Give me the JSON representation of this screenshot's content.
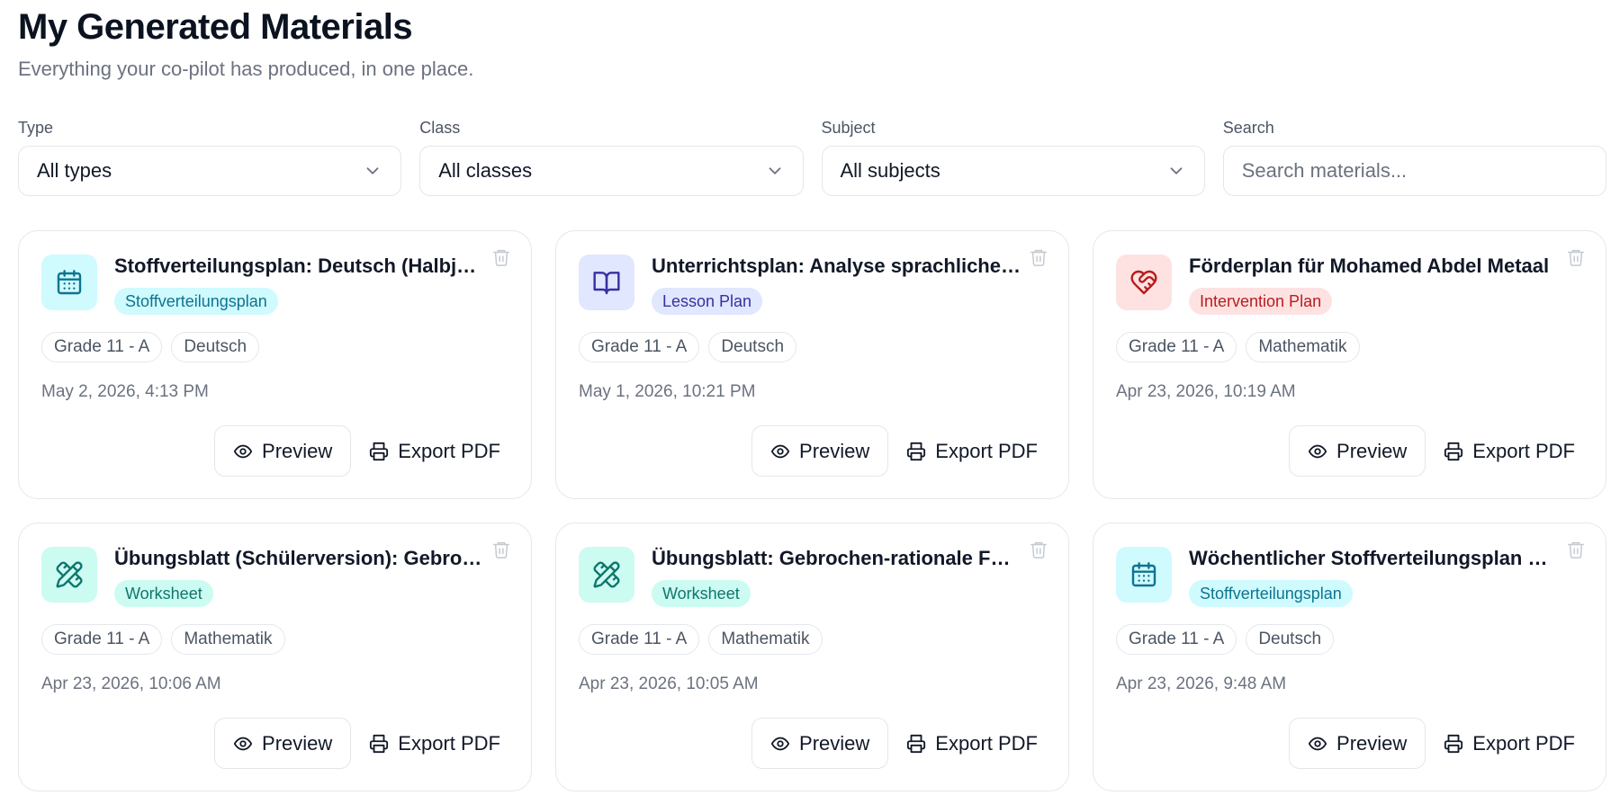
{
  "header": {
    "title": "My Generated Materials",
    "subtitle": "Everything your co-pilot has produced, in one place."
  },
  "filters": {
    "type": {
      "label": "Type",
      "value": "All types"
    },
    "class": {
      "label": "Class",
      "value": "All classes"
    },
    "subject": {
      "label": "Subject",
      "value": "All subjects"
    },
    "search": {
      "label": "Search",
      "placeholder": "Search materials..."
    }
  },
  "actions": {
    "preview_label": "Preview",
    "export_label": "Export PDF"
  },
  "colors": {
    "calendar_bg": "#cffafe",
    "calendar_fg": "#0e7490",
    "lesson_bg": "#e0e7ff",
    "lesson_fg": "#3730a3",
    "intervention_bg": "#fee2e2",
    "intervention_fg": "#b91c1c",
    "worksheet_bg": "#ccfbf1",
    "worksheet_fg": "#0f766e"
  },
  "materials": [
    {
      "title": "Stoffverteilungsplan: Deutsch (Halbjahr)",
      "type": "Stoffverteilungsplan",
      "icon": "calendar-icon",
      "grade": "Grade 11 - A",
      "subject": "Deutsch",
      "date": "May 2, 2026, 4:13 PM"
    },
    {
      "title": "Unterrichtsplan: Analyse sprachlicher Mittel",
      "type": "Lesson Plan",
      "icon": "book-open-icon",
      "grade": "Grade 11 - A",
      "subject": "Deutsch",
      "date": "May 1, 2026, 10:21 PM"
    },
    {
      "title": "Förderplan für Mohamed Abdel Metaal",
      "type": "Intervention Plan",
      "icon": "heart-handshake-icon",
      "grade": "Grade 11 - A",
      "subject": "Mathematik",
      "date": "Apr 23, 2026, 10:19 AM"
    },
    {
      "title": "Übungsblatt (Schülerversion): Gebrochen-rationale Funktionen",
      "type": "Worksheet",
      "icon": "pencil-ruler-icon",
      "grade": "Grade 11 - A",
      "subject": "Mathematik",
      "date": "Apr 23, 2026, 10:06 AM"
    },
    {
      "title": "Übungsblatt: Gebrochen-rationale Funktionen",
      "type": "Worksheet",
      "icon": "pencil-ruler-icon",
      "grade": "Grade 11 - A",
      "subject": "Mathematik",
      "date": "Apr 23, 2026, 10:05 AM"
    },
    {
      "title": "Wöchentlicher Stoffverteilungsplan Deutsch",
      "type": "Stoffverteilungsplan",
      "icon": "calendar-icon",
      "grade": "Grade 11 - A",
      "subject": "Deutsch",
      "date": "Apr 23, 2026, 9:48 AM"
    }
  ]
}
